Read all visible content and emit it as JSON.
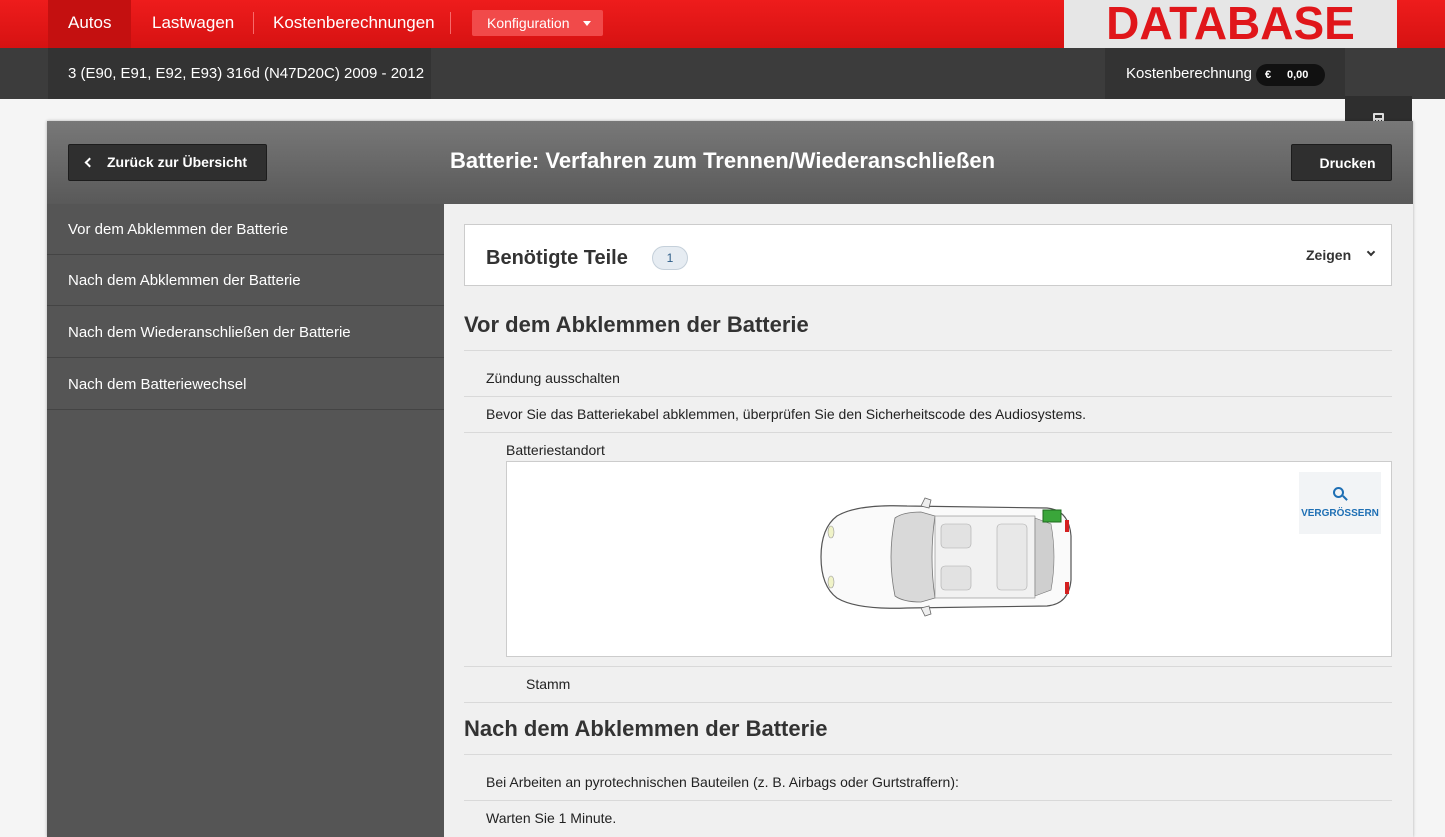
{
  "topnav": {
    "items": [
      "Autos",
      "Lastwagen",
      "Kostenberechnungen"
    ],
    "config_label": "Konfiguration",
    "logo_text": "DATABASE"
  },
  "subbar": {
    "vehicle": "3 (E90, E91, E92, E93) 316d (N47D20C) 2009 - 2012",
    "cost_label": "Kostenberechnung",
    "currency": "€",
    "amount": "0,00",
    "calculator_icon": "calculator-icon"
  },
  "header": {
    "back_label": "Zurück zur Übersicht",
    "title": "Batterie: Verfahren zum Trennen/Wiederanschließen",
    "print_label": "Drucken"
  },
  "sidebar": {
    "items": [
      {
        "label": "Vor dem Abklemmen der Batterie"
      },
      {
        "label": "Nach dem Abklemmen der Batterie"
      },
      {
        "label": "Nach dem Wiederanschließen der Batterie"
      },
      {
        "label": "Nach dem Batteriewechsel"
      }
    ]
  },
  "parts": {
    "title": "Benötigte Teile",
    "count": "1",
    "toggle_label": "Zeigen"
  },
  "sections": [
    {
      "title": "Vor dem Abklemmen der Batterie",
      "rows": [
        "Zündung ausschalten",
        "Bevor Sie das Batteriekabel abklemmen, überprüfen Sie den Sicherheitscode des Audiosystems."
      ],
      "image_label": "Batteriestandort",
      "zoom_label": "VERGRÖSSERN",
      "location": "Stamm"
    },
    {
      "title": "Nach dem Abklemmen der Batterie",
      "rows": [
        "Bei Arbeiten an pyrotechnischen Bauteilen (z. B. Airbags oder Gurtstraffern):",
        "Warten Sie 1 Minute."
      ]
    }
  ],
  "colors": {
    "brand_red": "#e0161a",
    "nav_red": "#ee1c1c",
    "link_blue": "#1e6fb4",
    "battery_green": "#3aa63a"
  }
}
